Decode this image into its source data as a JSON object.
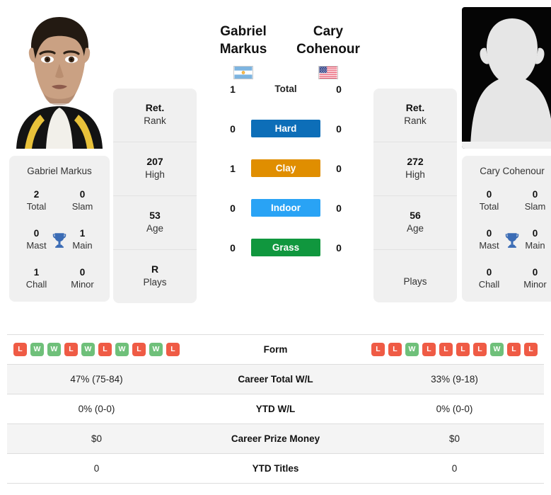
{
  "players": {
    "left": {
      "first_name": "Gabriel",
      "last_name": "Markus",
      "full_name": "Gabriel Markus",
      "flag": "argentina-flag",
      "photo": "player-headshot",
      "rank": "Ret.",
      "rank_label": "Rank",
      "high": "207",
      "high_label": "High",
      "age": "53",
      "age_label": "Age",
      "plays": "R",
      "plays_label": "Plays",
      "titles": {
        "total": "2",
        "total_label": "Total",
        "slam": "0",
        "slam_label": "Slam",
        "mast": "0",
        "mast_label": "Mast",
        "main": "1",
        "main_label": "Main",
        "chall": "1",
        "chall_label": "Chall",
        "minor": "0",
        "minor_label": "Minor"
      },
      "form": [
        "L",
        "W",
        "W",
        "L",
        "W",
        "L",
        "W",
        "L",
        "W",
        "L"
      ],
      "career_total_wl": "47% (75-84)",
      "ytd_wl": "0% (0-0)",
      "career_prize_money": "$0",
      "ytd_titles": "0"
    },
    "right": {
      "first_name": "Cary",
      "last_name": "Cohenour",
      "full_name": "Cary Cohenour",
      "flag": "usa-flag",
      "photo": "player-silhouette-placeholder",
      "rank": "Ret.",
      "rank_label": "Rank",
      "high": "272",
      "high_label": "High",
      "age": "56",
      "age_label": "Age",
      "plays": "",
      "plays_label": "Plays",
      "titles": {
        "total": "0",
        "total_label": "Total",
        "slam": "0",
        "slam_label": "Slam",
        "mast": "0",
        "mast_label": "Mast",
        "main": "0",
        "main_label": "Main",
        "chall": "0",
        "chall_label": "Chall",
        "minor": "0",
        "minor_label": "Minor"
      },
      "form": [
        "L",
        "L",
        "W",
        "L",
        "L",
        "L",
        "L",
        "W",
        "L",
        "L"
      ],
      "career_total_wl": "33% (9-18)",
      "ytd_wl": "0% (0-0)",
      "career_prize_money": "$0",
      "ytd_titles": "0"
    }
  },
  "h2h": {
    "rows": [
      {
        "label": "Total",
        "left": "1",
        "right": "0",
        "color": "",
        "style": "plain"
      },
      {
        "label": "Hard",
        "left": "0",
        "right": "0",
        "color": "#0d6eb8",
        "style": "badge"
      },
      {
        "label": "Clay",
        "left": "1",
        "right": "0",
        "color": "#e08e00",
        "style": "badge"
      },
      {
        "label": "Indoor",
        "left": "0",
        "right": "0",
        "color": "#29a3f5",
        "style": "badge"
      },
      {
        "label": "Grass",
        "left": "0",
        "right": "0",
        "color": "#10973e",
        "style": "badge"
      }
    ]
  },
  "table": {
    "rows": [
      {
        "label": "Form",
        "type": "form"
      },
      {
        "label": "Career Total W/L",
        "type": "text",
        "key": "career_total_wl"
      },
      {
        "label": "YTD W/L",
        "type": "text",
        "key": "ytd_wl"
      },
      {
        "label": "Career Prize Money",
        "type": "text",
        "key": "career_prize_money"
      },
      {
        "label": "YTD Titles",
        "type": "text",
        "key": "ytd_titles"
      }
    ]
  },
  "colors": {
    "win": "#6fc07a",
    "loss": "#ef5b45",
    "card_bg": "#f0f0f0",
    "row_alt_bg": "#f4f4f4",
    "trophy": "#3b6cb5"
  }
}
